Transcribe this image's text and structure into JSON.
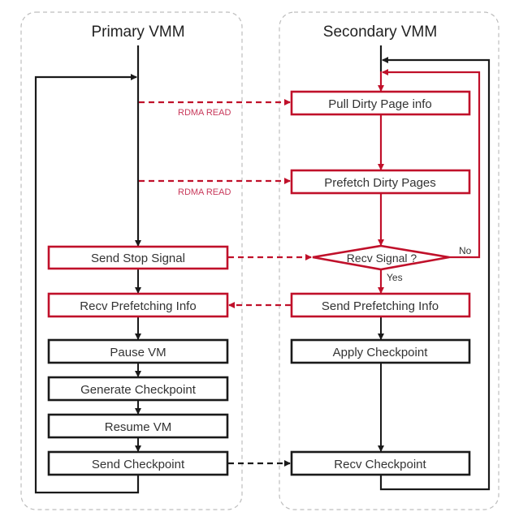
{
  "colors": {
    "red": "#c0102a",
    "black": "#1a1a1a",
    "lane_border": "#bdbdbd",
    "rdma_label": "#c8385a"
  },
  "lanes": {
    "primary": {
      "title": "Primary VMM"
    },
    "secondary": {
      "title": "Secondary VMM"
    }
  },
  "primary_steps": [
    {
      "id": "send-stop-signal",
      "label": "Send Stop Signal",
      "style": "red"
    },
    {
      "id": "recv-prefetching-info",
      "label": "Recv Prefetching Info",
      "style": "red"
    },
    {
      "id": "pause-vm",
      "label": "Pause VM",
      "style": "black"
    },
    {
      "id": "generate-checkpoint",
      "label": "Generate Checkpoint",
      "style": "black"
    },
    {
      "id": "resume-vm",
      "label": "Resume VM",
      "style": "black"
    },
    {
      "id": "send-checkpoint",
      "label": "Send Checkpoint",
      "style": "black"
    }
  ],
  "secondary_steps": [
    {
      "id": "pull-dirty-page-info",
      "label": "Pull Dirty Page info",
      "style": "red"
    },
    {
      "id": "prefetch-dirty-pages",
      "label": "Prefetch Dirty Pages",
      "style": "red"
    },
    {
      "id": "recv-signal",
      "label": "Recv Signal ?",
      "style": "red",
      "shape": "diamond"
    },
    {
      "id": "send-prefetching-info",
      "label": "Send Prefetching Info",
      "style": "red"
    },
    {
      "id": "apply-checkpoint",
      "label": "Apply Checkpoint",
      "style": "black"
    },
    {
      "id": "recv-checkpoint",
      "label": "Recv Checkpoint",
      "style": "black"
    }
  ],
  "edge_labels": {
    "rdma_read_1": "RDMA READ",
    "rdma_read_2": "RDMA READ",
    "decision_yes": "Yes",
    "decision_no": "No"
  }
}
